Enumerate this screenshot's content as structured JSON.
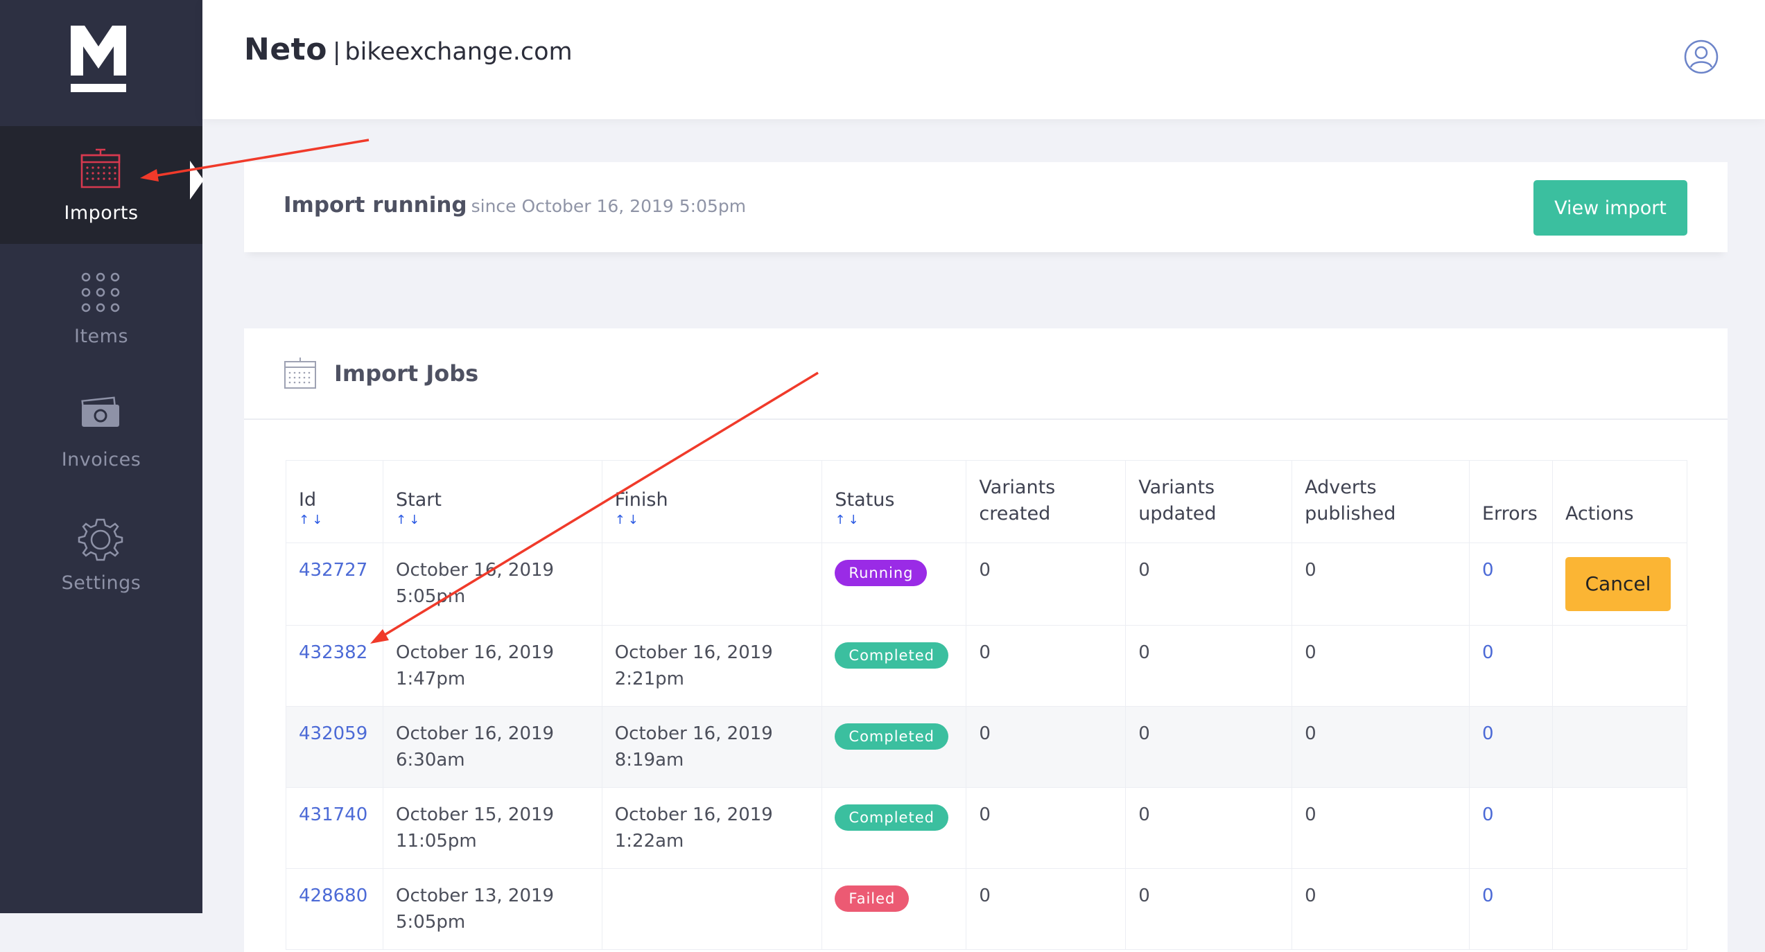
{
  "sidebar": {
    "logo_letter": "M",
    "items": [
      {
        "label": "Imports",
        "icon": "calendar-icon",
        "active": true
      },
      {
        "label": "Items",
        "icon": "grid-dots-icon",
        "active": false
      },
      {
        "label": "Invoices",
        "icon": "money-icon",
        "active": false
      },
      {
        "label": "Settings",
        "icon": "gear-icon",
        "active": false
      }
    ]
  },
  "header": {
    "brand": "Neto",
    "separator": "|",
    "site": "bikeexchange.com",
    "user_icon": "user-circle-icon"
  },
  "running": {
    "title": "Import running",
    "since": "since October 16, 2019 5:05pm",
    "button": "View import"
  },
  "jobs": {
    "title": "Import Jobs",
    "icon": "calendar-icon",
    "columns": [
      "Id",
      "Start",
      "Finish",
      "Status",
      "Variants created",
      "Variants updated",
      "Adverts published",
      "Errors",
      "Actions"
    ],
    "sort_arrows": "↑↓",
    "rows": [
      {
        "id": "432727",
        "start_date": "October 16, 2019",
        "start_time": "5:05pm",
        "finish_date": "",
        "finish_time": "",
        "status": "Running",
        "variants_created": "0",
        "variants_updated": "0",
        "adverts_published": "0",
        "errors": "0",
        "action": "Cancel"
      },
      {
        "id": "432382",
        "start_date": "October 16, 2019",
        "start_time": "1:47pm",
        "finish_date": "October 16, 2019",
        "finish_time": "2:21pm",
        "status": "Completed",
        "variants_created": "0",
        "variants_updated": "0",
        "adverts_published": "0",
        "errors": "0",
        "action": ""
      },
      {
        "id": "432059",
        "start_date": "October 16, 2019",
        "start_time": "6:30am",
        "finish_date": "October 16, 2019",
        "finish_time": "8:19am",
        "status": "Completed",
        "variants_created": "0",
        "variants_updated": "0",
        "adverts_published": "0",
        "errors": "0",
        "action": ""
      },
      {
        "id": "431740",
        "start_date": "October 15, 2019",
        "start_time": "11:05pm",
        "finish_date": "October 16, 2019",
        "finish_time": "1:22am",
        "status": "Completed",
        "variants_created": "0",
        "variants_updated": "0",
        "adverts_published": "0",
        "errors": "0",
        "action": ""
      },
      {
        "id": "428680",
        "start_date": "October 13, 2019",
        "start_time": "5:05pm",
        "finish_date": "",
        "finish_time": "",
        "status": "Failed",
        "variants_created": "0",
        "variants_updated": "0",
        "adverts_published": "0",
        "errors": "0",
        "action": ""
      }
    ]
  },
  "colors": {
    "sidebar": "#2d3042",
    "sidebar_active": "#23252f",
    "accent_green": "#3bbf9f",
    "running": "#9a2be6",
    "completed": "#3bbf9f",
    "failed": "#ec5a73",
    "cancel": "#fbb534",
    "link": "#4c6ad6",
    "annotation_arrow": "#f03a2a"
  }
}
